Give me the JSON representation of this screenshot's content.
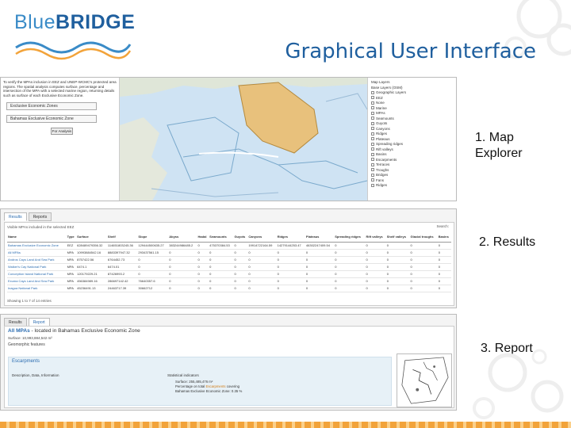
{
  "brand": {
    "logo_blue": "Blue",
    "logo_bridge": "BRIDGE"
  },
  "slide_title": "Graphical User Interface",
  "labels": {
    "map_explorer": "1. Map\nExplorer",
    "results": "2. Results",
    "report": "3. Report"
  },
  "colors": {
    "accent": "#1f5f9e",
    "map_water": "#cfe3f3",
    "highlight_area": "#e8c17c",
    "orange": "#f2a33a"
  },
  "map_explorer": {
    "description": "To verify the MPAs inclusion in EEZ and UNEP-WCMC's protected area regions. The spatial analysis computes surface, percentage and intersection of the MPA with a selected marine region, returning details such as surface of each Exclusive Economic Zone.",
    "select_1": "Exclusive Economic Zones",
    "select_2": "Bahamas Exclusive Economic Zone",
    "analyse_button": "For Analysis",
    "layers": [
      "Map Layers",
      "Base Layers (OSM)",
      "Geographic Layers",
      "EEZ",
      "None",
      "Marine",
      "MPAs",
      "Seamounts",
      "Guyots",
      "Canyons",
      "Ridges",
      "Plateaus",
      "Spreading ridges",
      "Rift valleys",
      "Basins",
      "Escarpments",
      "Terraces",
      "Troughs",
      "Bridges",
      "Fans",
      "Ridges"
    ]
  },
  "results": {
    "tabs": [
      "Results",
      "Reports"
    ],
    "status": "Visible MPAs included in the selected EEZ",
    "search": "Search:",
    "columns": [
      "Name",
      "Type",
      "Surface",
      "Shelf",
      "Slope",
      "Abyss",
      "Hadal",
      "Seamounts",
      "Guyots",
      "Canyons",
      "Ridges",
      "Plateaus",
      "Spreading ridges",
      "Rift valleys",
      "Shelf valleys",
      "Glacial troughs",
      "Basins"
    ],
    "rows": [
      {
        "name": "Bahamas Exclusive Economic Zone",
        "type": "EEZ",
        "surface": "628489479356.32",
        "shelf": "114651803245.36",
        "slope": "129444500635.27",
        "abyss": "383244986485.2",
        "v": [
          "0",
          "475370384.53",
          "0",
          "19914722164.59",
          "14279144253.47",
          "46302247409.54",
          "0",
          "0",
          "0",
          "0",
          "0"
        ]
      },
      {
        "name": "All MPAs",
        "type": "MPA",
        "surface": "10993884542.16",
        "shelf": "8883397947.32",
        "slope": "293437561.15",
        "abyss": "0",
        "v": [
          "0",
          "0",
          "0",
          "0",
          "0",
          "0",
          "0",
          "0",
          "0",
          "0",
          "0"
        ]
      },
      {
        "name": "Andros Cays Land And Sea Park",
        "type": "MPA",
        "surface": "8757422.56",
        "shelf": "6764452.73",
        "slope": "0",
        "abyss": "0",
        "v": [
          "0",
          "0",
          "0",
          "0",
          "0",
          "0",
          "0",
          "0",
          "0",
          "0",
          "0"
        ]
      },
      {
        "name": "Walker's Cay National Park",
        "type": "MPA",
        "surface": "6474.1",
        "shelf": "6474.01",
        "slope": "0",
        "abyss": "0",
        "v": [
          "0",
          "0",
          "0",
          "0",
          "0",
          "0",
          "0",
          "0",
          "0",
          "0",
          "0"
        ]
      },
      {
        "name": "Conception Island National Park",
        "type": "MPA",
        "surface": "120179229.21",
        "shelf": "87426993.2",
        "slope": "0",
        "abyss": "0",
        "v": [
          "0",
          "0",
          "0",
          "0",
          "0",
          "0",
          "0",
          "0",
          "0",
          "0",
          "0"
        ]
      },
      {
        "name": "Exuma Cays Land And Sea Park",
        "type": "MPA",
        "surface": "456384989.16",
        "shelf": "286697142.42",
        "slope": "76640357.6",
        "abyss": "0",
        "v": [
          "0",
          "0",
          "0",
          "0",
          "0",
          "0",
          "0",
          "0",
          "0",
          "0",
          "0"
        ]
      },
      {
        "name": "Inagua National Park",
        "type": "MPA",
        "surface": "45236491.13",
        "shelf": "24463717.39",
        "slope": "30662712",
        "abyss": "0",
        "v": [
          "0",
          "0",
          "0",
          "0",
          "0",
          "0",
          "0",
          "0",
          "0",
          "0",
          "0"
        ]
      }
    ],
    "footer": "Showing 1 to 7 of 14 entries"
  },
  "report": {
    "tabs": [
      "Results",
      "Report"
    ],
    "title_prefix": "All MPAs",
    "title_rest": " - located in Bahamas Exclusive Economic Zone",
    "surface": "Surface: 10,993,884,542 m²",
    "geo_label": "Geomorphic features",
    "panel_title": "Escarpments",
    "panel_desc": "Description, Data, Information",
    "stats_label": "Statistical indicators",
    "stats": [
      "Surface: 255,485,476 m²",
      "Percentage on total",
      "Escarpments",
      "covering",
      "Bahamas Exclusive Economic Zone: 0.35 %"
    ]
  }
}
